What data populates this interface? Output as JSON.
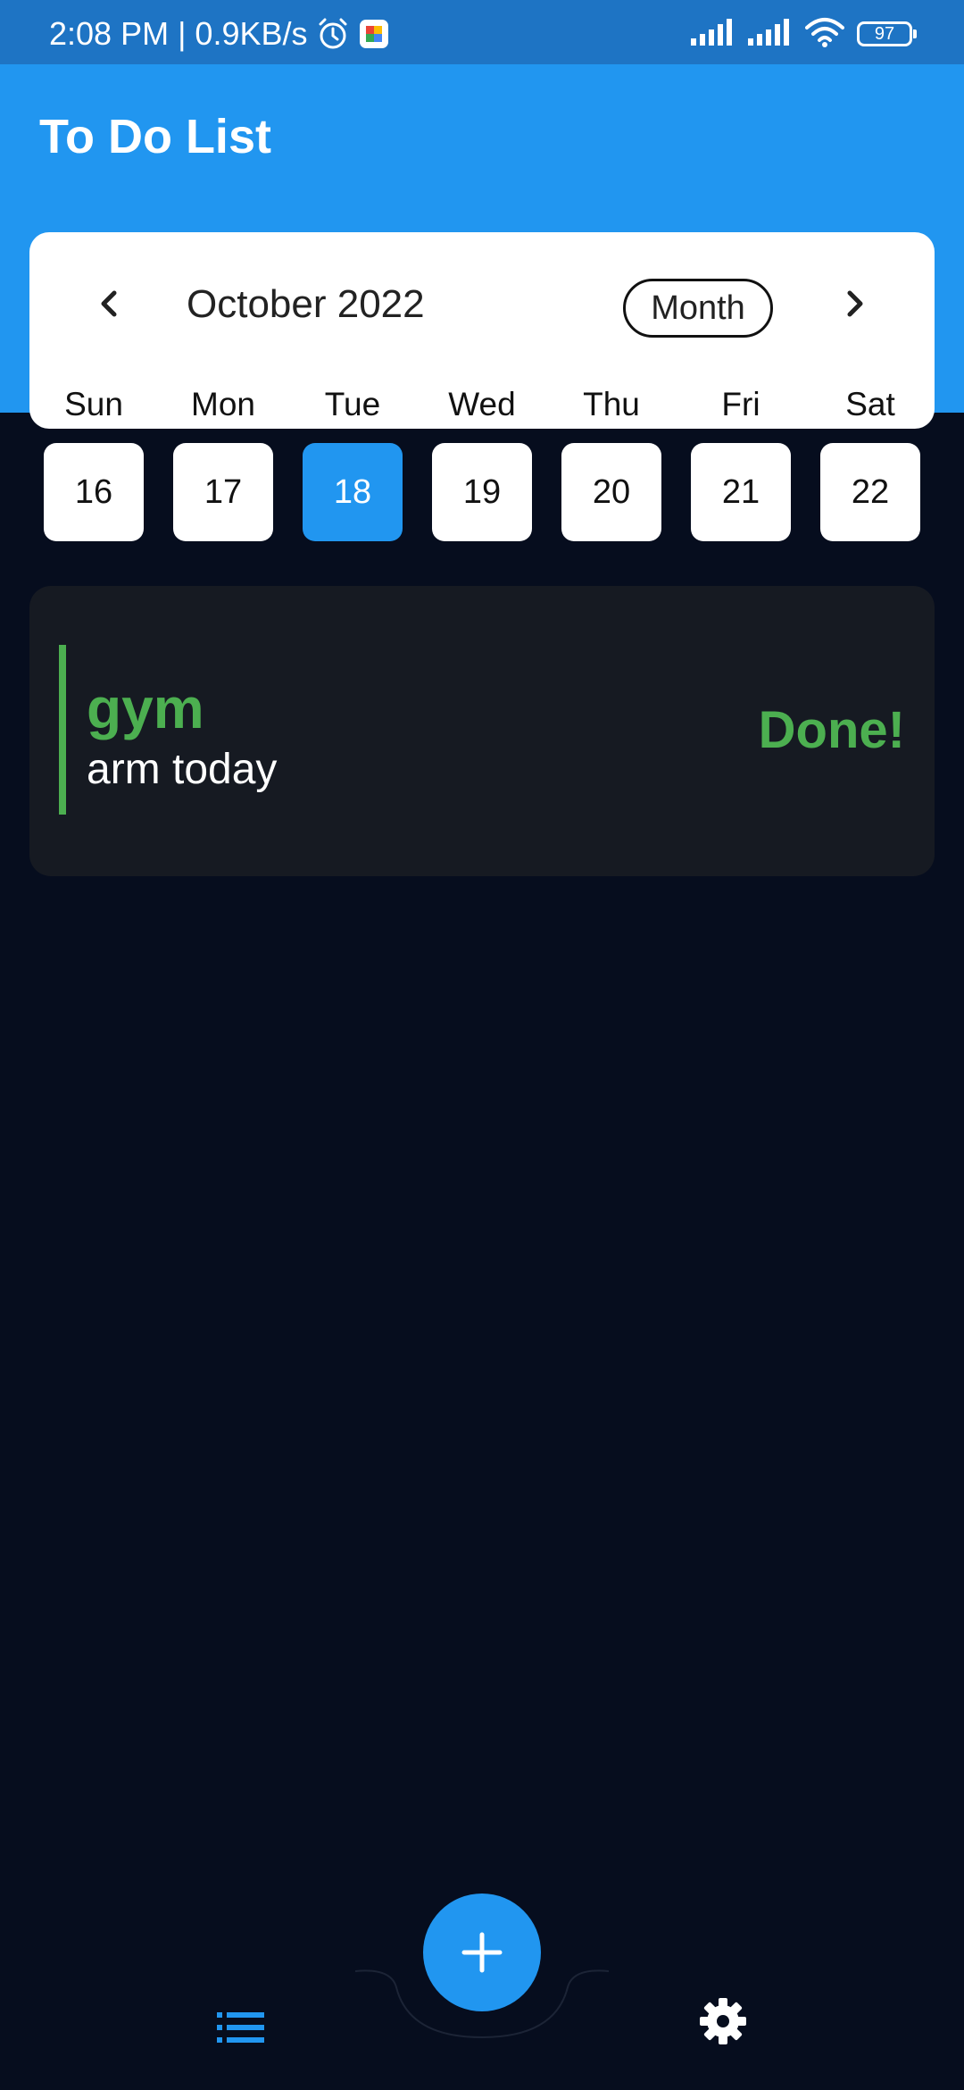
{
  "status_bar": {
    "time_speed": "2:08 PM | 0.9KB/s",
    "battery": "97",
    "icons": [
      "alarm-icon",
      "app-notification-icon",
      "signal-icon",
      "signal-icon",
      "wifi-icon",
      "battery-icon"
    ]
  },
  "app": {
    "title": "To Do List",
    "accent_color": "#2196f0",
    "background_color": "#060d1e"
  },
  "calendar": {
    "month_label": "October 2022",
    "view_toggle": "Month",
    "prev_icon": "chevron-left-icon",
    "next_icon": "chevron-right-icon",
    "weekdays": [
      "Sun",
      "Mon",
      "Tue",
      "Wed",
      "Thu",
      "Fri",
      "Sat"
    ],
    "dates": [
      "16",
      "17",
      "18",
      "19",
      "20",
      "21",
      "22"
    ],
    "selected_date": "18"
  },
  "tasks": [
    {
      "title": "gym",
      "description": "arm today",
      "status": "Done!",
      "status_color": "#4caf50"
    }
  ],
  "bottom_nav": {
    "add_icon": "plus-icon",
    "list_icon": "list-icon",
    "settings_icon": "gear-icon"
  }
}
